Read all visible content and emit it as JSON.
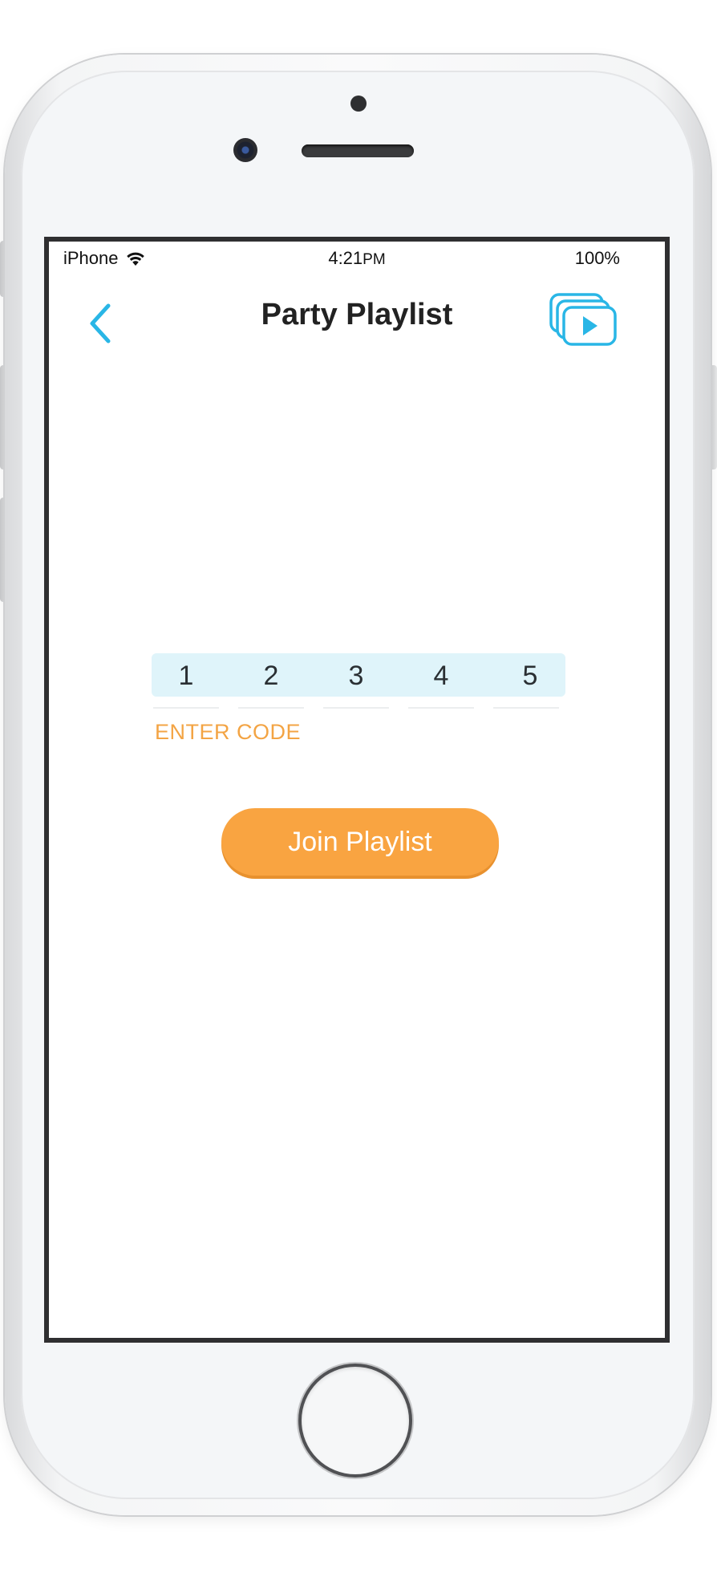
{
  "status_bar": {
    "carrier": "iPhone",
    "time_hour": "4:21",
    "time_suffix": "PM",
    "battery": "100%"
  },
  "nav": {
    "title": "Party Playlist",
    "back_icon": "chevron-left-icon",
    "playlists_icon": "stacked-video-play-icon"
  },
  "code_entry": {
    "digits": [
      "1",
      "2",
      "3",
      "4",
      "5"
    ],
    "label": "ENTER CODE"
  },
  "actions": {
    "join_label": "Join Playlist"
  },
  "colors": {
    "accent_blue": "#29b6e6",
    "accent_orange": "#f9a441",
    "code_box_bg": "#dff4fa"
  }
}
